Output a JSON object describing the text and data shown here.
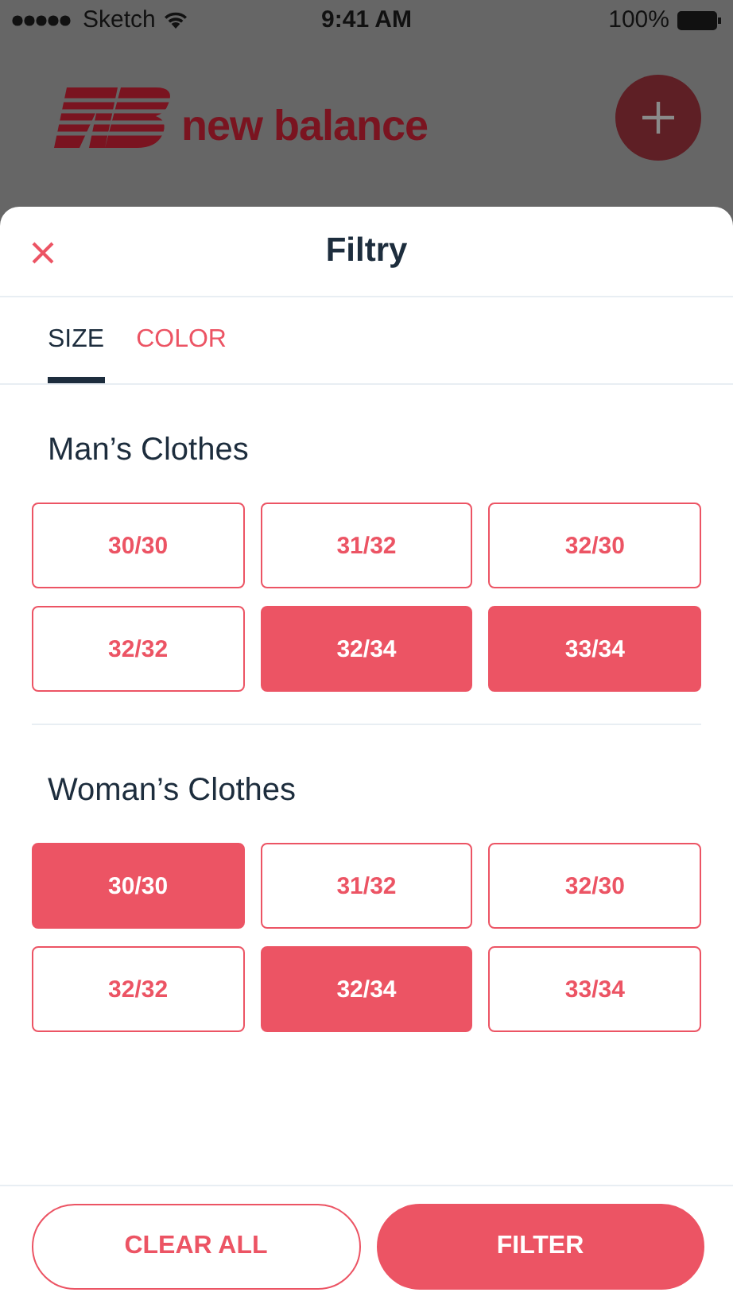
{
  "status_bar": {
    "carrier": "Sketch",
    "time": "9:41 AM",
    "battery": "100%"
  },
  "background": {
    "brand": "new balance"
  },
  "sheet": {
    "title": "Filtry",
    "tabs": [
      {
        "label": "SIZE",
        "selected": true
      },
      {
        "label": "COLOR",
        "selected": false
      }
    ],
    "sections": [
      {
        "title": "Man’s Clothes",
        "sizes": [
          {
            "label": "30/30",
            "selected": false
          },
          {
            "label": "31/32",
            "selected": false
          },
          {
            "label": "32/30",
            "selected": false
          },
          {
            "label": "32/32",
            "selected": false
          },
          {
            "label": "32/34",
            "selected": true
          },
          {
            "label": "33/34",
            "selected": true
          }
        ]
      },
      {
        "title": "Woman’s Clothes",
        "sizes": [
          {
            "label": "30/30",
            "selected": true
          },
          {
            "label": "31/32",
            "selected": false
          },
          {
            "label": "32/30",
            "selected": false
          },
          {
            "label": "32/32",
            "selected": false
          },
          {
            "label": "32/34",
            "selected": true
          },
          {
            "label": "33/34",
            "selected": false
          }
        ]
      }
    ],
    "buttons": [
      {
        "label": "CLEAR ALL",
        "kind": "outline"
      },
      {
        "label": "FILTER",
        "kind": "filled"
      }
    ]
  }
}
